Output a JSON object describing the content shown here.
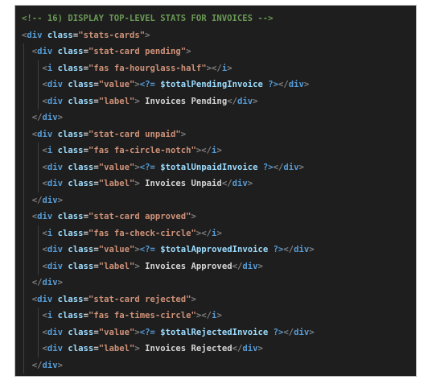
{
  "editor": {
    "lines": [
      {
        "indent": 0,
        "tokens": [
          {
            "t": "<!-- 16) DISPLAY TOP-LEVEL STATS FOR INVOICES -->",
            "c": "comment"
          }
        ]
      },
      {
        "indent": 0,
        "tokens": [
          {
            "t": "<",
            "c": "bracket"
          },
          {
            "t": "div",
            "c": "tag"
          },
          {
            "t": " class",
            "c": "attr"
          },
          {
            "t": "=",
            "c": "eq"
          },
          {
            "t": "\"stats-cards\"",
            "c": "str"
          },
          {
            "t": ">",
            "c": "bracket"
          }
        ]
      },
      {
        "indent": 1,
        "tokens": [
          {
            "t": "<",
            "c": "bracket"
          },
          {
            "t": "div",
            "c": "tag"
          },
          {
            "t": " class",
            "c": "attr"
          },
          {
            "t": "=",
            "c": "eq"
          },
          {
            "t": "\"stat-card pending\"",
            "c": "str"
          },
          {
            "t": ">",
            "c": "bracket"
          }
        ]
      },
      {
        "indent": 2,
        "tokens": [
          {
            "t": "<",
            "c": "bracket"
          },
          {
            "t": "i",
            "c": "tag"
          },
          {
            "t": " class",
            "c": "attr"
          },
          {
            "t": "=",
            "c": "eq"
          },
          {
            "t": "\"fas fa-hourglass-half\"",
            "c": "str"
          },
          {
            "t": "></",
            "c": "bracket"
          },
          {
            "t": "i",
            "c": "tag"
          },
          {
            "t": ">",
            "c": "bracket"
          }
        ]
      },
      {
        "indent": 2,
        "tokens": [
          {
            "t": "<",
            "c": "bracket"
          },
          {
            "t": "div",
            "c": "tag"
          },
          {
            "t": " class",
            "c": "attr"
          },
          {
            "t": "=",
            "c": "eq"
          },
          {
            "t": "\"value\"",
            "c": "str"
          },
          {
            "t": ">",
            "c": "bracket"
          },
          {
            "t": "<?=",
            "c": "php"
          },
          {
            "t": " $totalPendingInvoice",
            "c": "var"
          },
          {
            "t": " ?>",
            "c": "php"
          },
          {
            "t": "</",
            "c": "bracket"
          },
          {
            "t": "div",
            "c": "tag"
          },
          {
            "t": ">",
            "c": "bracket"
          }
        ]
      },
      {
        "indent": 2,
        "tokens": [
          {
            "t": "<",
            "c": "bracket"
          },
          {
            "t": "div",
            "c": "tag"
          },
          {
            "t": " class",
            "c": "attr"
          },
          {
            "t": "=",
            "c": "eq"
          },
          {
            "t": "\"label\"",
            "c": "str"
          },
          {
            "t": ">",
            "c": "bracket"
          },
          {
            "t": " Invoices Pending",
            "c": "text"
          },
          {
            "t": "</",
            "c": "bracket"
          },
          {
            "t": "div",
            "c": "tag"
          },
          {
            "t": ">",
            "c": "bracket"
          }
        ]
      },
      {
        "indent": 1,
        "tokens": [
          {
            "t": "</",
            "c": "bracket"
          },
          {
            "t": "div",
            "c": "tag"
          },
          {
            "t": ">",
            "c": "bracket"
          }
        ]
      },
      {
        "indent": 1,
        "tokens": [
          {
            "t": "<",
            "c": "bracket"
          },
          {
            "t": "div",
            "c": "tag"
          },
          {
            "t": " class",
            "c": "attr"
          },
          {
            "t": "=",
            "c": "eq"
          },
          {
            "t": "\"stat-card unpaid\"",
            "c": "str"
          },
          {
            "t": ">",
            "c": "bracket"
          }
        ]
      },
      {
        "indent": 2,
        "tokens": [
          {
            "t": "<",
            "c": "bracket"
          },
          {
            "t": "i",
            "c": "tag"
          },
          {
            "t": " class",
            "c": "attr"
          },
          {
            "t": "=",
            "c": "eq"
          },
          {
            "t": "\"fas fa-circle-notch\"",
            "c": "str"
          },
          {
            "t": "></",
            "c": "bracket"
          },
          {
            "t": "i",
            "c": "tag"
          },
          {
            "t": ">",
            "c": "bracket"
          }
        ]
      },
      {
        "indent": 2,
        "tokens": [
          {
            "t": "<",
            "c": "bracket"
          },
          {
            "t": "div",
            "c": "tag"
          },
          {
            "t": " class",
            "c": "attr"
          },
          {
            "t": "=",
            "c": "eq"
          },
          {
            "t": "\"value\"",
            "c": "str"
          },
          {
            "t": ">",
            "c": "bracket"
          },
          {
            "t": "<?=",
            "c": "php"
          },
          {
            "t": " $totalUnpaidInvoice",
            "c": "var"
          },
          {
            "t": " ?>",
            "c": "php"
          },
          {
            "t": "</",
            "c": "bracket"
          },
          {
            "t": "div",
            "c": "tag"
          },
          {
            "t": ">",
            "c": "bracket"
          }
        ]
      },
      {
        "indent": 2,
        "tokens": [
          {
            "t": "<",
            "c": "bracket"
          },
          {
            "t": "div",
            "c": "tag"
          },
          {
            "t": " class",
            "c": "attr"
          },
          {
            "t": "=",
            "c": "eq"
          },
          {
            "t": "\"label\"",
            "c": "str"
          },
          {
            "t": ">",
            "c": "bracket"
          },
          {
            "t": " Invoices Unpaid",
            "c": "text"
          },
          {
            "t": "</",
            "c": "bracket"
          },
          {
            "t": "div",
            "c": "tag"
          },
          {
            "t": ">",
            "c": "bracket"
          }
        ]
      },
      {
        "indent": 1,
        "tokens": [
          {
            "t": "</",
            "c": "bracket"
          },
          {
            "t": "div",
            "c": "tag"
          },
          {
            "t": ">",
            "c": "bracket"
          }
        ]
      },
      {
        "indent": 1,
        "tokens": [
          {
            "t": "<",
            "c": "bracket"
          },
          {
            "t": "div",
            "c": "tag"
          },
          {
            "t": " class",
            "c": "attr"
          },
          {
            "t": "=",
            "c": "eq"
          },
          {
            "t": "\"stat-card approved\"",
            "c": "str"
          },
          {
            "t": ">",
            "c": "bracket"
          }
        ]
      },
      {
        "indent": 2,
        "tokens": [
          {
            "t": "<",
            "c": "bracket"
          },
          {
            "t": "i",
            "c": "tag"
          },
          {
            "t": " class",
            "c": "attr"
          },
          {
            "t": "=",
            "c": "eq"
          },
          {
            "t": "\"fas fa-check-circle\"",
            "c": "str"
          },
          {
            "t": "></",
            "c": "bracket"
          },
          {
            "t": "i",
            "c": "tag"
          },
          {
            "t": ">",
            "c": "bracket"
          }
        ]
      },
      {
        "indent": 2,
        "tokens": [
          {
            "t": "<",
            "c": "bracket"
          },
          {
            "t": "div",
            "c": "tag"
          },
          {
            "t": " class",
            "c": "attr"
          },
          {
            "t": "=",
            "c": "eq"
          },
          {
            "t": "\"value\"",
            "c": "str"
          },
          {
            "t": ">",
            "c": "bracket"
          },
          {
            "t": "<?=",
            "c": "php"
          },
          {
            "t": " $totalApprovedInvoice",
            "c": "var"
          },
          {
            "t": " ?>",
            "c": "php"
          },
          {
            "t": "</",
            "c": "bracket"
          },
          {
            "t": "div",
            "c": "tag"
          },
          {
            "t": ">",
            "c": "bracket"
          }
        ]
      },
      {
        "indent": 2,
        "tokens": [
          {
            "t": "<",
            "c": "bracket"
          },
          {
            "t": "div",
            "c": "tag"
          },
          {
            "t": " class",
            "c": "attr"
          },
          {
            "t": "=",
            "c": "eq"
          },
          {
            "t": "\"label\"",
            "c": "str"
          },
          {
            "t": ">",
            "c": "bracket"
          },
          {
            "t": " Invoices Approved",
            "c": "text"
          },
          {
            "t": "</",
            "c": "bracket"
          },
          {
            "t": "div",
            "c": "tag"
          },
          {
            "t": ">",
            "c": "bracket"
          }
        ]
      },
      {
        "indent": 1,
        "tokens": [
          {
            "t": "</",
            "c": "bracket"
          },
          {
            "t": "div",
            "c": "tag"
          },
          {
            "t": ">",
            "c": "bracket"
          }
        ]
      },
      {
        "indent": 1,
        "tokens": [
          {
            "t": "<",
            "c": "bracket"
          },
          {
            "t": "div",
            "c": "tag"
          },
          {
            "t": " class",
            "c": "attr"
          },
          {
            "t": "=",
            "c": "eq"
          },
          {
            "t": "\"stat-card rejected\"",
            "c": "str"
          },
          {
            "t": ">",
            "c": "bracket"
          }
        ]
      },
      {
        "indent": 2,
        "tokens": [
          {
            "t": "<",
            "c": "bracket"
          },
          {
            "t": "i",
            "c": "tag"
          },
          {
            "t": " class",
            "c": "attr"
          },
          {
            "t": "=",
            "c": "eq"
          },
          {
            "t": "\"fas fa-times-circle\"",
            "c": "str"
          },
          {
            "t": "></",
            "c": "bracket"
          },
          {
            "t": "i",
            "c": "tag"
          },
          {
            "t": ">",
            "c": "bracket"
          }
        ]
      },
      {
        "indent": 2,
        "tokens": [
          {
            "t": "<",
            "c": "bracket"
          },
          {
            "t": "div",
            "c": "tag"
          },
          {
            "t": " class",
            "c": "attr"
          },
          {
            "t": "=",
            "c": "eq"
          },
          {
            "t": "\"value\"",
            "c": "str"
          },
          {
            "t": ">",
            "c": "bracket"
          },
          {
            "t": "<?=",
            "c": "php"
          },
          {
            "t": " $totalRejectedInvoice",
            "c": "var"
          },
          {
            "t": " ?>",
            "c": "php"
          },
          {
            "t": "</",
            "c": "bracket"
          },
          {
            "t": "div",
            "c": "tag"
          },
          {
            "t": ">",
            "c": "bracket"
          }
        ]
      },
      {
        "indent": 2,
        "tokens": [
          {
            "t": "<",
            "c": "bracket"
          },
          {
            "t": "div",
            "c": "tag"
          },
          {
            "t": " class",
            "c": "attr"
          },
          {
            "t": "=",
            "c": "eq"
          },
          {
            "t": "\"label\"",
            "c": "str"
          },
          {
            "t": ">",
            "c": "bracket"
          },
          {
            "t": " Invoices Rejected",
            "c": "text"
          },
          {
            "t": "</",
            "c": "bracket"
          },
          {
            "t": "div",
            "c": "tag"
          },
          {
            "t": ">",
            "c": "bracket"
          }
        ]
      },
      {
        "indent": 1,
        "tokens": [
          {
            "t": "</",
            "c": "bracket"
          },
          {
            "t": "div",
            "c": "tag"
          },
          {
            "t": ">",
            "c": "bracket"
          }
        ]
      },
      {
        "indent": 0,
        "tokens": [
          {
            "t": "</",
            "c": "bracket"
          },
          {
            "t": "div",
            "c": "tag"
          },
          {
            "t": ">",
            "c": "bracket"
          }
        ]
      }
    ]
  },
  "colors": {
    "background": "#1e1e1e",
    "comment": "#6a9955",
    "tag": "#569cd6",
    "attribute": "#9cdcfe",
    "string": "#ce9178",
    "text": "#d4d4d4"
  }
}
